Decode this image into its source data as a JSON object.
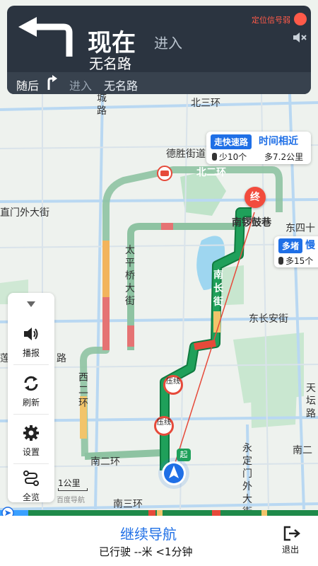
{
  "banner": {
    "distance_now": "现在",
    "enter": "进入",
    "road": "无名路",
    "gps_status": "定位信号弱",
    "then_label": "随后",
    "then_enter": "进入",
    "then_road": "无名路"
  },
  "route_tags": [
    {
      "tag": "走快速路",
      "text": "时间相近",
      "lights": "少10个",
      "distance": "多7.2公里"
    },
    {
      "tag": "多堵",
      "text": "慢",
      "lights": "多15个",
      "distance": ""
    }
  ],
  "map_labels": {
    "cheng_lu": "城路",
    "bei_san_huan": "北三环",
    "desheng": "德胜街道",
    "bei_er_huan": "北二环",
    "zhongdian": "终",
    "nanluoguxiang": "南锣鼓巷",
    "dong_si": "东四十",
    "xizhimen": "直门外大街",
    "taipingqiao": "太平桥大街",
    "nanchangjie": "南长街",
    "dongchangan": "东长安街",
    "lian": "莲",
    "lu": "路",
    "xi_er_huan": "西二环",
    "tiantan": "天坛路",
    "nan_er_huan_left": "南二环",
    "nan_er_huan_right": "南二",
    "yongding": "永定门外大街",
    "nan_san_huan": "南三环",
    "ya_xian": "压线",
    "qi": "起"
  },
  "controls": {
    "broadcast": "播报",
    "refresh": "刷新",
    "settings": "设置",
    "overview": "全览"
  },
  "scale": "1公里",
  "watermark": "百度导航",
  "footer": {
    "continue": "继续导航",
    "stats": "已行驶 --米 <1分钟",
    "exit": "退出"
  },
  "colors": {
    "accent": "#1f6fe6",
    "banner_bg": "#2b3440",
    "route_green": "#1fa05a",
    "route_red": "#e64a3a",
    "warn_red": "#ff5a49"
  }
}
